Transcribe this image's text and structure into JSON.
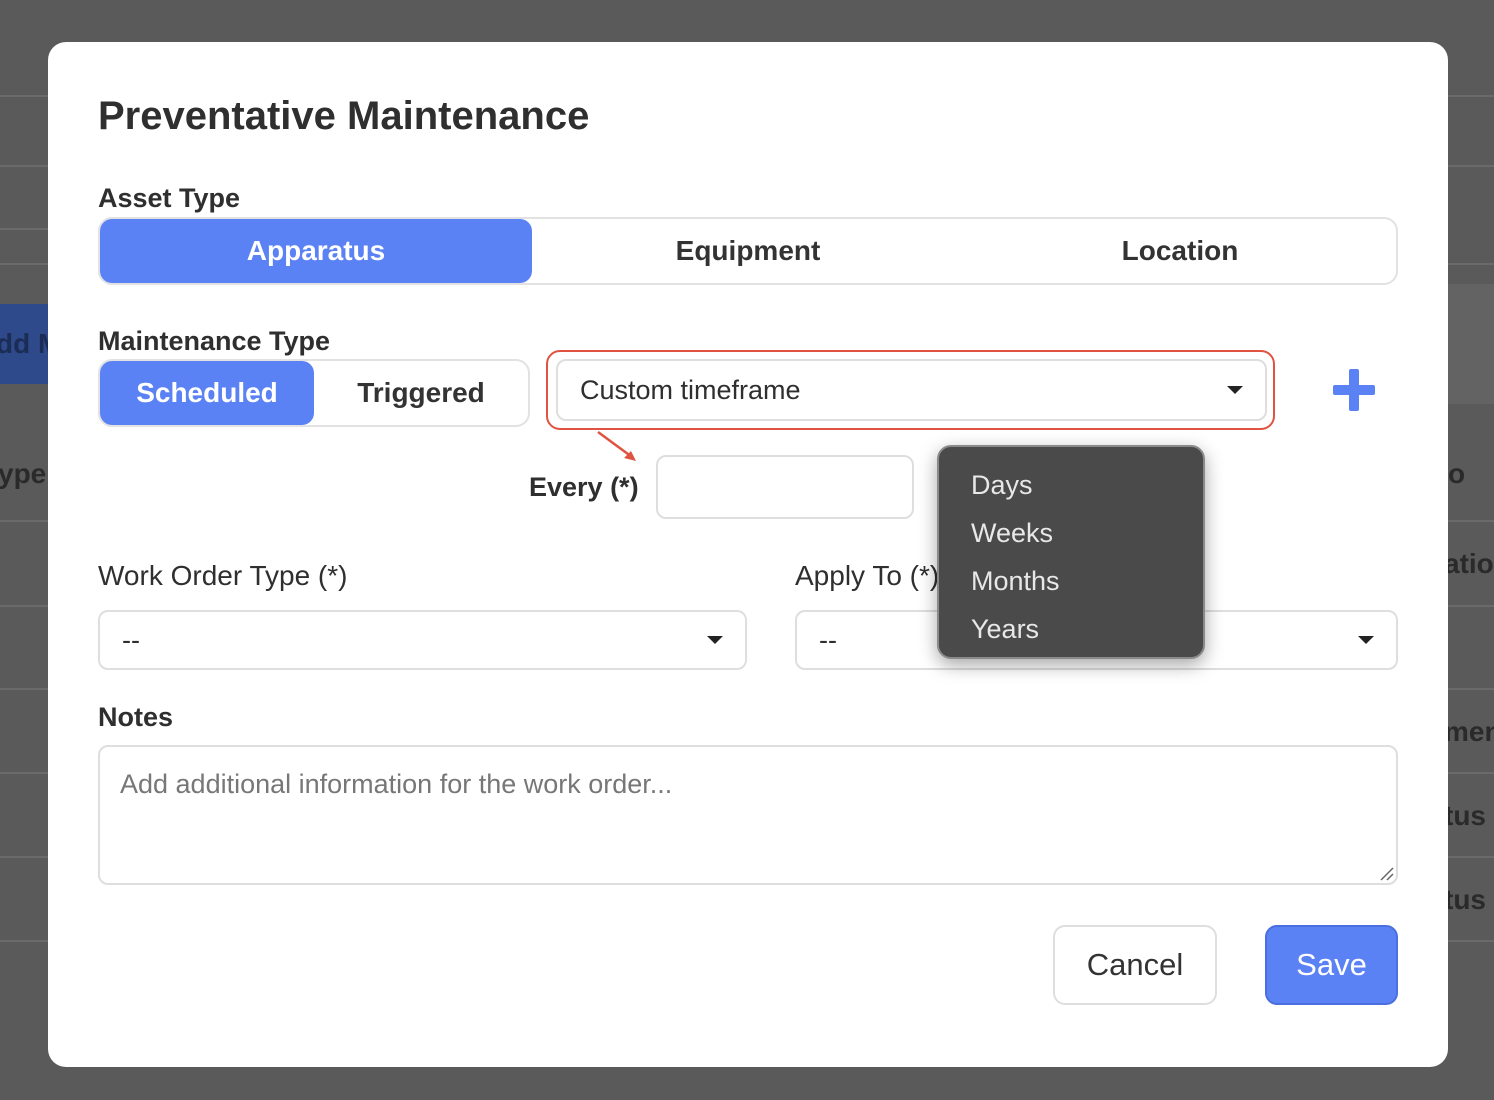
{
  "background": {
    "add_button_fragment": "dd M",
    "left_col_fragment": "ype",
    "right_col_fragments": [
      "o",
      "atio",
      "ment",
      "tus",
      "tus"
    ]
  },
  "modal": {
    "title": "Preventative Maintenance",
    "asset_type": {
      "label": "Asset Type",
      "options": [
        "Apparatus",
        "Equipment",
        "Location"
      ],
      "selected": "Apparatus"
    },
    "maintenance_type": {
      "label": "Maintenance Type",
      "options": [
        "Scheduled",
        "Triggered"
      ],
      "selected": "Scheduled"
    },
    "timeframe_select": {
      "value": "Custom timeframe"
    },
    "every": {
      "label": "Every (*)",
      "value": ""
    },
    "unit_dropdown": {
      "options": [
        "Days",
        "Weeks",
        "Months",
        "Years"
      ]
    },
    "work_order_type": {
      "label": "Work Order Type (*)",
      "value": "--"
    },
    "apply_to": {
      "label": "Apply To (*)",
      "value": "--"
    },
    "notes": {
      "label": "Notes",
      "placeholder": "Add additional information for the work order..."
    },
    "buttons": {
      "cancel": "Cancel",
      "save": "Save"
    },
    "colors": {
      "accent": "#5b82f5",
      "highlight_outline": "#e05340",
      "dropdown_bg": "#4a4a4a"
    }
  }
}
